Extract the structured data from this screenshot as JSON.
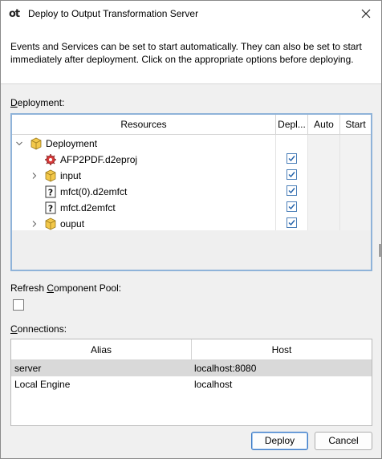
{
  "window": {
    "title": "Deploy to Output Transformation Server",
    "logo_text": "ot"
  },
  "header": {
    "description": "Events and Services can be set to start automatically.  They can also be set to start immediately after deployment.  Click on the appropriate options before deploying."
  },
  "deployment": {
    "label_prefix": "",
    "label_mnemonic": "D",
    "label_rest": "eployment:",
    "columns": {
      "resources": "Resources",
      "deploy": "Depl...",
      "auto": "Auto",
      "start": "Start"
    },
    "rows": [
      {
        "label": "Deployment",
        "icon": "package-icon",
        "level": 0,
        "expander": "expanded",
        "deploy": null
      },
      {
        "label": "AFP2PDF.d2eproj",
        "icon": "project-gear-icon",
        "level": 1,
        "expander": "none",
        "deploy": true
      },
      {
        "label": "input",
        "icon": "package-icon",
        "level": 1,
        "expander": "collapsed",
        "deploy": true
      },
      {
        "label": "mfct(0).d2emfct",
        "icon": "unknown-file-icon",
        "level": 1,
        "expander": "none",
        "deploy": true
      },
      {
        "label": "mfct.d2emfct",
        "icon": "unknown-file-icon",
        "level": 1,
        "expander": "none",
        "deploy": true
      },
      {
        "label": "ouput",
        "icon": "package-icon",
        "level": 1,
        "expander": "collapsed",
        "deploy": true
      }
    ]
  },
  "refresh": {
    "label_before": "Refresh ",
    "label_mnemonic": "C",
    "label_after": "omponent Pool:",
    "checked": false
  },
  "connections": {
    "label_mnemonic": "C",
    "label_rest": "onnections:",
    "columns": {
      "alias": "Alias",
      "host": "Host"
    },
    "rows": [
      {
        "alias": "server",
        "host": "localhost:8080",
        "selected": true
      },
      {
        "alias": "Local Engine",
        "host": "localhost",
        "selected": false
      }
    ]
  },
  "buttons": {
    "deploy": "Deploy",
    "cancel": "Cancel"
  },
  "colors": {
    "accent_border": "#8fb3d9",
    "checkbox_blue": "#1f5fa8",
    "selected_row": "#d9d9d9",
    "package_yellow": "#f3c84a"
  }
}
